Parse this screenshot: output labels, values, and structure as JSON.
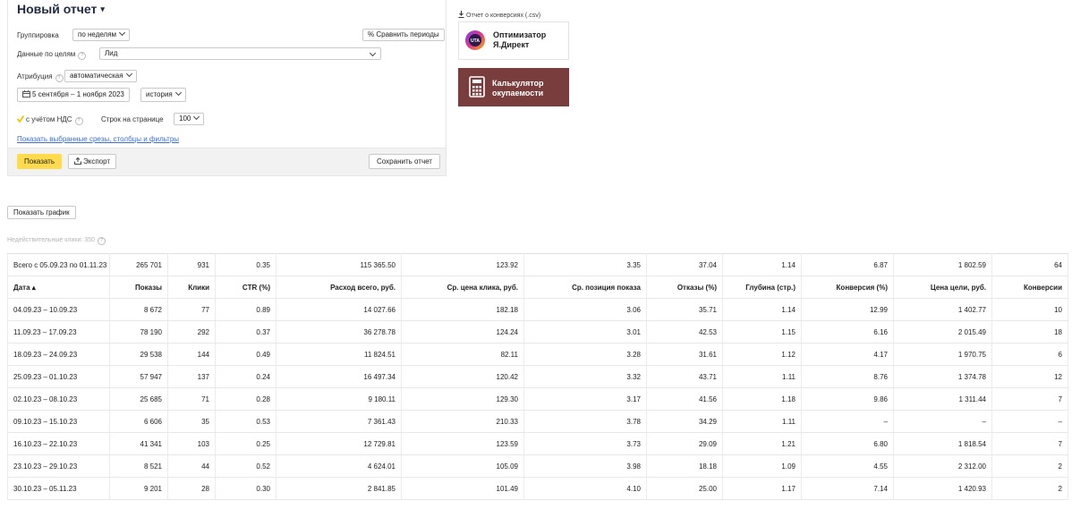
{
  "report": {
    "title": "Новый отчет",
    "title_caret": "▾",
    "grouping": {
      "label": "Группировка",
      "value": "по неделям"
    },
    "compare_label": "Сравнить периоды",
    "goals": {
      "label": "Данные по целям",
      "value": "Лид"
    },
    "attribution": {
      "label": "Атрибуция",
      "value": "автоматическая"
    },
    "date_range": "5 сентября – 1 ноября 2023",
    "history": "история",
    "vat_label": "с учётом НДС",
    "rows_per_page": {
      "label": "Строк на странице",
      "value": "100"
    },
    "show_slices_link": "Показать выбранные срезы, столбцы и фильтры",
    "show_button": "Показать",
    "export_button": "Экспорт",
    "save_button": "Сохранить отчет"
  },
  "promo": {
    "conversion_link": "Отчет о конверсиях (.csv)",
    "optimizer": {
      "line1": "Оптимизатор",
      "line2": "Я.Директ",
      "logo_text": "UTA"
    },
    "calculator": {
      "line1": "Калькулятор",
      "line2": "окупаемости"
    }
  },
  "show_chart_button": "Показать график",
  "invalid_clicks": "Недействительные клики: 350",
  "table": {
    "total": [
      "Всего с 05.09.23 по 01.11.23",
      "265 701",
      "931",
      "0.35",
      "115 365.50",
      "123.92",
      "3.35",
      "37.04",
      "1.14",
      "6.87",
      "1 802.59",
      "64"
    ],
    "headers": [
      "Дата ▴",
      "Показы",
      "Клики",
      "CTR (%)",
      "Расход всего, руб.",
      "Ср. цена клика, руб.",
      "Ср. позиция показа",
      "Отказы (%)",
      "Глубина (стр.)",
      "Конверсия (%)",
      "Цена цели, руб.",
      "Конверсии"
    ],
    "rows": [
      [
        "04.09.23 – 10.09.23",
        "8 672",
        "77",
        "0.89",
        "14 027.66",
        "182.18",
        "3.06",
        "35.71",
        "1.14",
        "12.99",
        "1 402.77",
        "10"
      ],
      [
        "11.09.23 – 17.09.23",
        "78 190",
        "292",
        "0.37",
        "36 278.78",
        "124.24",
        "3.01",
        "42.53",
        "1.15",
        "6.16",
        "2 015.49",
        "18"
      ],
      [
        "18.09.23 – 24.09.23",
        "29 538",
        "144",
        "0.49",
        "11 824.51",
        "82.11",
        "3.28",
        "31.61",
        "1.12",
        "4.17",
        "1 970.75",
        "6"
      ],
      [
        "25.09.23 – 01.10.23",
        "57 947",
        "137",
        "0.24",
        "16 497.34",
        "120.42",
        "3.32",
        "43.71",
        "1.11",
        "8.76",
        "1 374.78",
        "12"
      ],
      [
        "02.10.23 – 08.10.23",
        "25 685",
        "71",
        "0.28",
        "9 180.11",
        "129.30",
        "3.17",
        "41.56",
        "1.18",
        "9.86",
        "1 311.44",
        "7"
      ],
      [
        "09.10.23 – 15.10.23",
        "6 606",
        "35",
        "0.53",
        "7 361.43",
        "210.33",
        "3.78",
        "34.29",
        "1.11",
        "–",
        "–",
        "–"
      ],
      [
        "16.10.23 – 22.10.23",
        "41 341",
        "103",
        "0.25",
        "12 729.81",
        "123.59",
        "3.73",
        "29.09",
        "1.21",
        "6.80",
        "1 818.54",
        "7"
      ],
      [
        "23.10.23 – 29.10.23",
        "8 521",
        "44",
        "0.52",
        "4 624.01",
        "105.09",
        "3.98",
        "18.18",
        "1.09",
        "4.55",
        "2 312.00",
        "2"
      ],
      [
        "30.10.23 – 05.11.23",
        "9 201",
        "28",
        "0.30",
        "2 841.85",
        "101.49",
        "4.10",
        "25.00",
        "1.17",
        "7.14",
        "1 420.93",
        "2"
      ]
    ]
  },
  "colors": {
    "accent_yellow": "#ffdb4d",
    "link_blue": "#3b6fd0",
    "calculator_bg": "#7a3d3d",
    "checkbox_yellow": "#f5c400"
  },
  "icons": [
    "chevron-down-icon",
    "compare-icon",
    "help-icon",
    "calendar-icon",
    "checkbox-checked-icon",
    "export-icon",
    "download-icon",
    "uta-logo-icon",
    "calculator-icon"
  ]
}
